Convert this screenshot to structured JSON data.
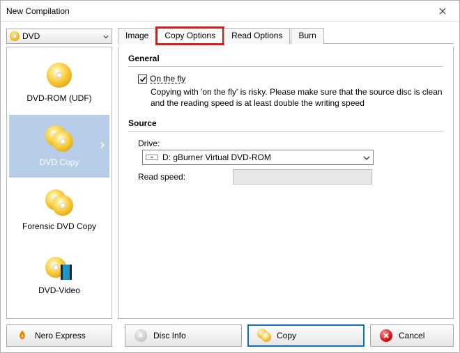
{
  "window": {
    "title": "New Compilation"
  },
  "selector": {
    "label": "DVD"
  },
  "tabs": [
    {
      "label": "Image",
      "active": false
    },
    {
      "label": "Copy Options",
      "active": true,
      "highlight": true
    },
    {
      "label": "Read Options",
      "active": false
    },
    {
      "label": "Burn",
      "active": false
    }
  ],
  "sidebar": {
    "items": [
      {
        "label": "DVD-ROM (UDF)",
        "icon": "disc-single",
        "selected": false
      },
      {
        "label": "DVD Copy",
        "icon": "disc-double",
        "selected": true
      },
      {
        "label": "Forensic DVD Copy",
        "icon": "disc-double",
        "selected": false
      },
      {
        "label": "DVD-Video",
        "icon": "disc-video",
        "selected": false
      }
    ]
  },
  "general": {
    "heading": "General",
    "on_the_fly": {
      "label": "On the fly",
      "checked": true
    },
    "note": "Copying with 'on the fly' is risky. Please make sure that the source disc is clean and the reading speed is at least double the writing speed"
  },
  "source": {
    "heading": "Source",
    "drive_label": "Drive:",
    "drive_value": "D: gBurner Virtual DVD-ROM",
    "read_speed_label": "Read speed:"
  },
  "footer": {
    "nero_express": "Nero Express",
    "disc_info": "Disc Info",
    "copy": "Copy",
    "cancel": "Cancel"
  }
}
